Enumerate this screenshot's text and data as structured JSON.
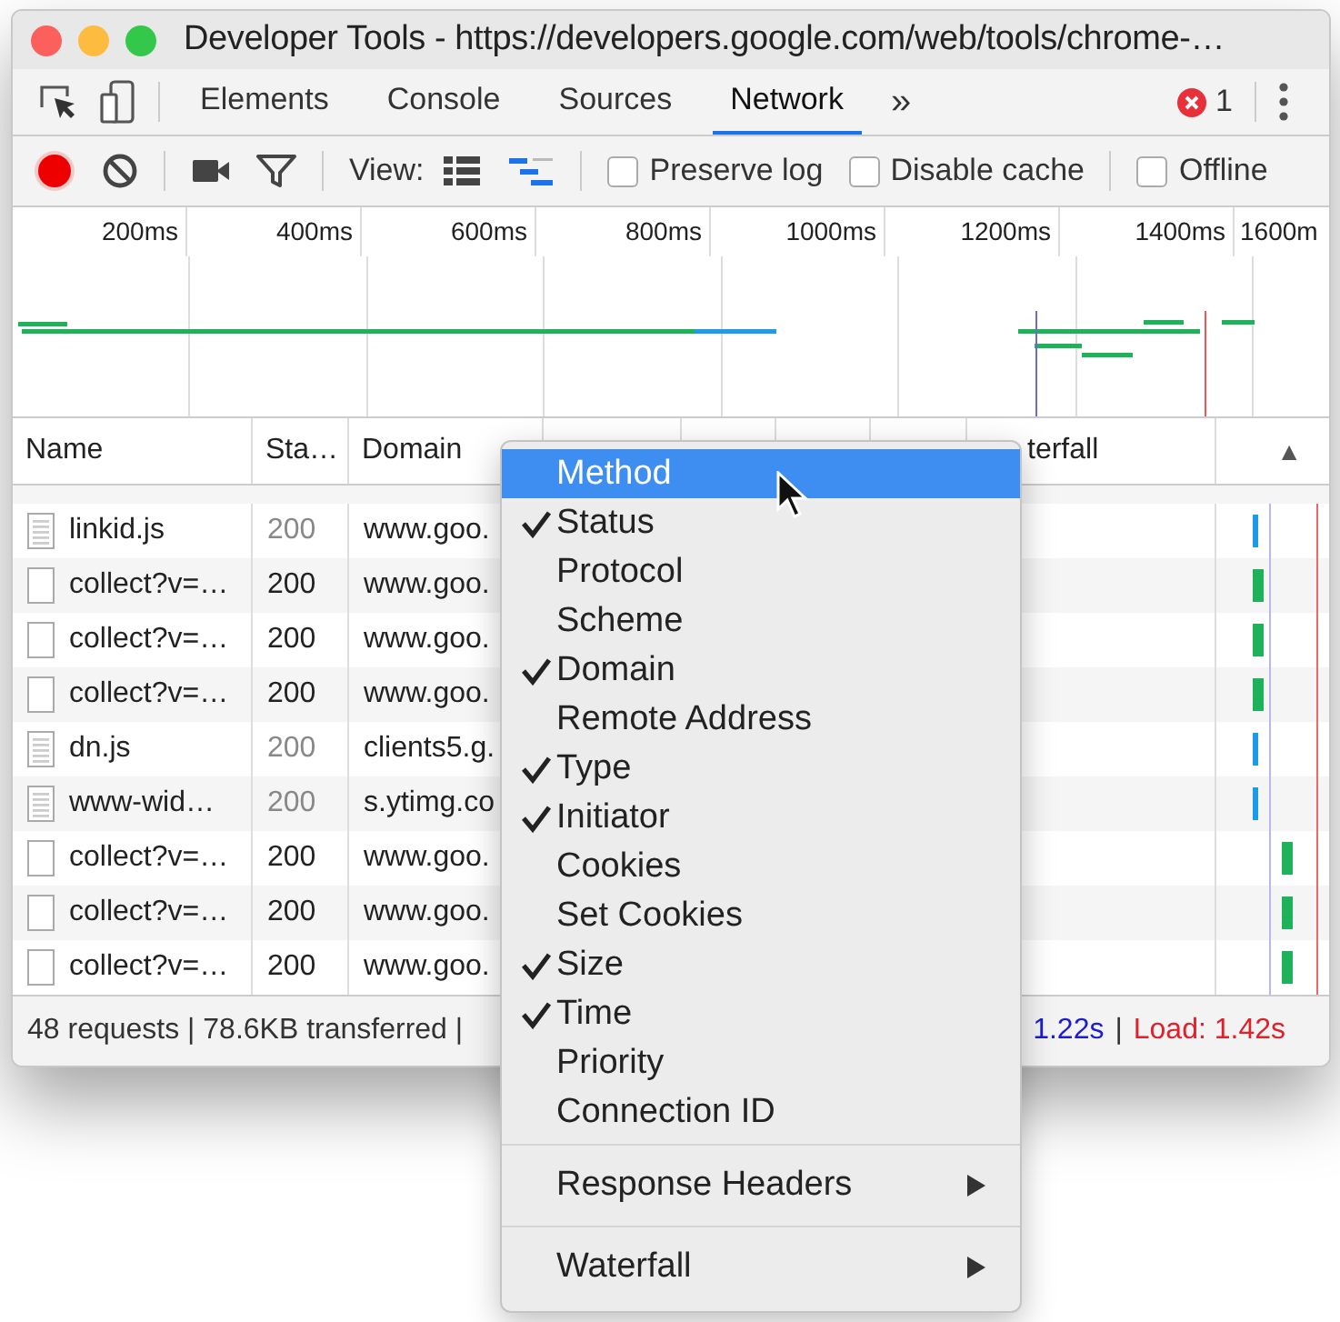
{
  "window": {
    "title": "Developer Tools - https://developers.google.com/web/tools/chrome-…"
  },
  "tabs": [
    {
      "label": "Elements",
      "selected": false
    },
    {
      "label": "Console",
      "selected": false
    },
    {
      "label": "Sources",
      "selected": false
    },
    {
      "label": "Network",
      "selected": true
    }
  ],
  "more_tabs": "»",
  "error_count": "1",
  "toolbar": {
    "recording": true,
    "view_label": "View:",
    "views": [
      {
        "kind": "list",
        "selected": false
      },
      {
        "kind": "waterfall",
        "selected": true
      }
    ],
    "checkboxes": [
      {
        "label": "Preserve log",
        "checked": false
      },
      {
        "label": "Disable cache",
        "checked": false
      },
      {
        "label": "Offline",
        "checked": false
      }
    ]
  },
  "overview": {
    "ticks": [
      "200ms",
      "400ms",
      "600ms",
      "800ms",
      "1000ms",
      "1200ms",
      "1400ms",
      "1600m"
    ]
  },
  "table": {
    "columns": [
      {
        "label": "Name"
      },
      {
        "label": "Sta…"
      },
      {
        "label": "Domain"
      },
      {},
      {},
      {},
      {},
      {
        "label": "terfall"
      },
      {
        "label": "▲",
        "kind": "sort"
      }
    ],
    "rows": [
      {
        "name": "linkid.js",
        "status": "200",
        "domain": "www.goo.",
        "kind": "script",
        "cached": true
      },
      {
        "name": "collect?v=…",
        "status": "200",
        "domain": "www.goo.",
        "kind": "document",
        "cached": false
      },
      {
        "name": "collect?v=…",
        "status": "200",
        "domain": "www.goo.",
        "kind": "document",
        "cached": false
      },
      {
        "name": "collect?v=…",
        "status": "200",
        "domain": "www.goo.",
        "kind": "document",
        "cached": false
      },
      {
        "name": "dn.js",
        "status": "200",
        "domain": "clients5.g.",
        "kind": "script",
        "cached": true
      },
      {
        "name": "www-wid…",
        "status": "200",
        "domain": "s.ytimg.co",
        "kind": "script",
        "cached": true
      },
      {
        "name": "collect?v=…",
        "status": "200",
        "domain": "www.goo.",
        "kind": "document",
        "cached": false
      },
      {
        "name": "collect?v=…",
        "status": "200",
        "domain": "www.goo.",
        "kind": "document",
        "cached": false
      },
      {
        "name": "collect?v=…",
        "status": "200",
        "domain": "www.goo.",
        "kind": "document",
        "cached": false
      }
    ]
  },
  "status_bar": {
    "summary": "48 requests | 78.6KB transferred |",
    "dom_content_loaded": "1.22s",
    "separator": "|",
    "load": "Load: 1.42s"
  },
  "context_menu": {
    "groups": [
      [
        {
          "label": "Method",
          "kind": "check",
          "checked": false,
          "selected": true
        },
        {
          "label": "Status",
          "kind": "check",
          "checked": true,
          "selected": false
        },
        {
          "label": "Protocol",
          "kind": "check",
          "checked": false,
          "selected": false
        },
        {
          "label": "Scheme",
          "kind": "check",
          "checked": false,
          "selected": false
        },
        {
          "label": "Domain",
          "kind": "check",
          "checked": true,
          "selected": false
        },
        {
          "label": "Remote Address",
          "kind": "check",
          "checked": false,
          "selected": false
        },
        {
          "label": "Type",
          "kind": "check",
          "checked": true,
          "selected": false
        },
        {
          "label": "Initiator",
          "kind": "check",
          "checked": true,
          "selected": false
        },
        {
          "label": "Cookies",
          "kind": "check",
          "checked": false,
          "selected": false
        },
        {
          "label": "Set Cookies",
          "kind": "check",
          "checked": false,
          "selected": false
        },
        {
          "label": "Size",
          "kind": "check",
          "checked": true,
          "selected": false
        },
        {
          "label": "Time",
          "kind": "check",
          "checked": true,
          "selected": false
        },
        {
          "label": "Priority",
          "kind": "check",
          "checked": false,
          "selected": false
        },
        {
          "label": "Connection ID",
          "kind": "check",
          "checked": false,
          "selected": false
        }
      ],
      [
        {
          "label": "Response Headers",
          "kind": "submenu",
          "selected": false
        }
      ],
      [
        {
          "label": "Waterfall",
          "kind": "submenu",
          "selected": false
        }
      ]
    ]
  }
}
